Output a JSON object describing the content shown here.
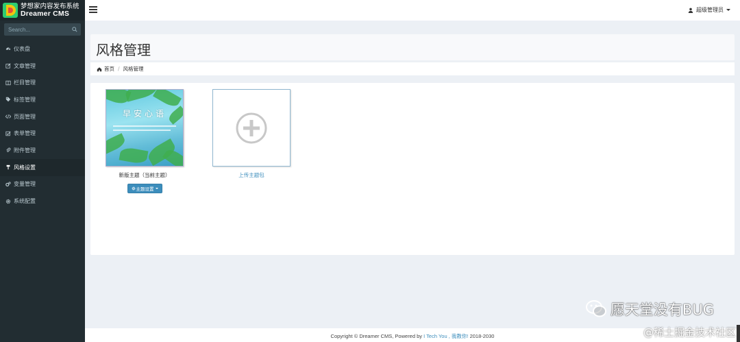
{
  "brand": {
    "title": "梦想家内容发布系统",
    "subtitle": "Dreamer CMS",
    "logo_colors": [
      "#e74c3c",
      "#2ecc71",
      "#f1c40f"
    ]
  },
  "search": {
    "placeholder": "Search..."
  },
  "menu": [
    {
      "label": "仪表盘",
      "icon": "dashboard-icon",
      "active": false
    },
    {
      "label": "文章管理",
      "icon": "edit-icon",
      "active": false
    },
    {
      "label": "栏目管理",
      "icon": "columns-icon",
      "active": false
    },
    {
      "label": "标签管理",
      "icon": "tags-icon",
      "active": false
    },
    {
      "label": "页面管理",
      "icon": "code-icon",
      "active": false
    },
    {
      "label": "表单管理",
      "icon": "checkbox-icon",
      "active": false
    },
    {
      "label": "附件管理",
      "icon": "paperclip-icon",
      "active": false
    },
    {
      "label": "风格设置",
      "icon": "paint-icon",
      "active": true
    },
    {
      "label": "变量管理",
      "icon": "cogs-icon",
      "active": false
    },
    {
      "label": "系统配置",
      "icon": "gear-icon",
      "active": false
    }
  ],
  "header": {
    "user_label": "超级管理员"
  },
  "page": {
    "title": "风格管理"
  },
  "breadcrumb": {
    "home": "首页",
    "current": "风格管理"
  },
  "themes": {
    "current": {
      "name": "新版主题（当前主题）",
      "thumb_text": "早安心语",
      "button_label": "主题设置"
    },
    "upload": {
      "label": "上传主题包"
    }
  },
  "footer": {
    "prefix": "Copyright © Dreamer CMS, Powered by",
    "link": "I Tech You , 我教你!",
    "years": "2018-2030"
  },
  "watermark": {
    "main": "愿天堂没有BUG",
    "sub": "@稀土掘金技术社区"
  },
  "colors": {
    "sidebar_bg": "#222d32",
    "accent": "#3c8dbc",
    "content_bg": "#ecf0f5"
  }
}
